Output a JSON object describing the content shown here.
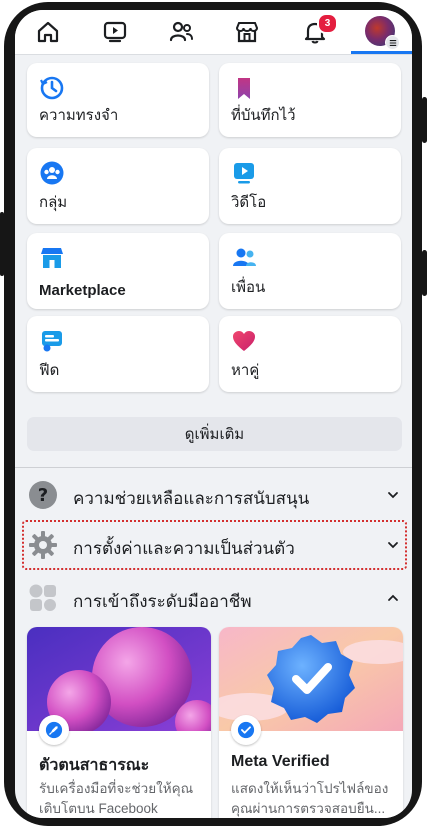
{
  "tabs": {
    "notifications_badge": "3"
  },
  "shortcuts": [
    {
      "label": "ความทรงจำ",
      "icon": "memories-clock-icon"
    },
    {
      "label": "ที่บันทึกไว้",
      "icon": "saved-bookmark-icon"
    },
    {
      "label": "กลุ่ม",
      "icon": "groups-icon"
    },
    {
      "label": "วิดีโอ",
      "icon": "video-icon"
    },
    {
      "label": "Marketplace",
      "icon": "marketplace-store-icon"
    },
    {
      "label": "เพื่อน",
      "icon": "friends-icon"
    },
    {
      "label": "ฟีด",
      "icon": "feeds-icon"
    },
    {
      "label": "หาคู่",
      "icon": "dating-heart-icon"
    }
  ],
  "see_more_label": "ดูเพิ่มเติม",
  "sections": {
    "help": "ความช่วยเหลือและการสนับสนุน",
    "settings": "การตั้งค่าและความเป็นส่วนตัว",
    "professional": "การเข้าถึงระดับมืออาชีพ"
  },
  "pro_cards": [
    {
      "title": "ตัวตนสาธารณะ",
      "description": "รับเครื่องมือที่จะช่วยให้คุณเติบโตบน Facebook"
    },
    {
      "title": "Meta Verified",
      "description": "แสดงให้เห็นว่าโปรไฟล์ของคุณผ่านการตรวจสอบยืน..."
    }
  ],
  "colors": {
    "accent": "#1877f2",
    "badge": "#e41e3f",
    "highlight_border": "#d32f2f"
  }
}
